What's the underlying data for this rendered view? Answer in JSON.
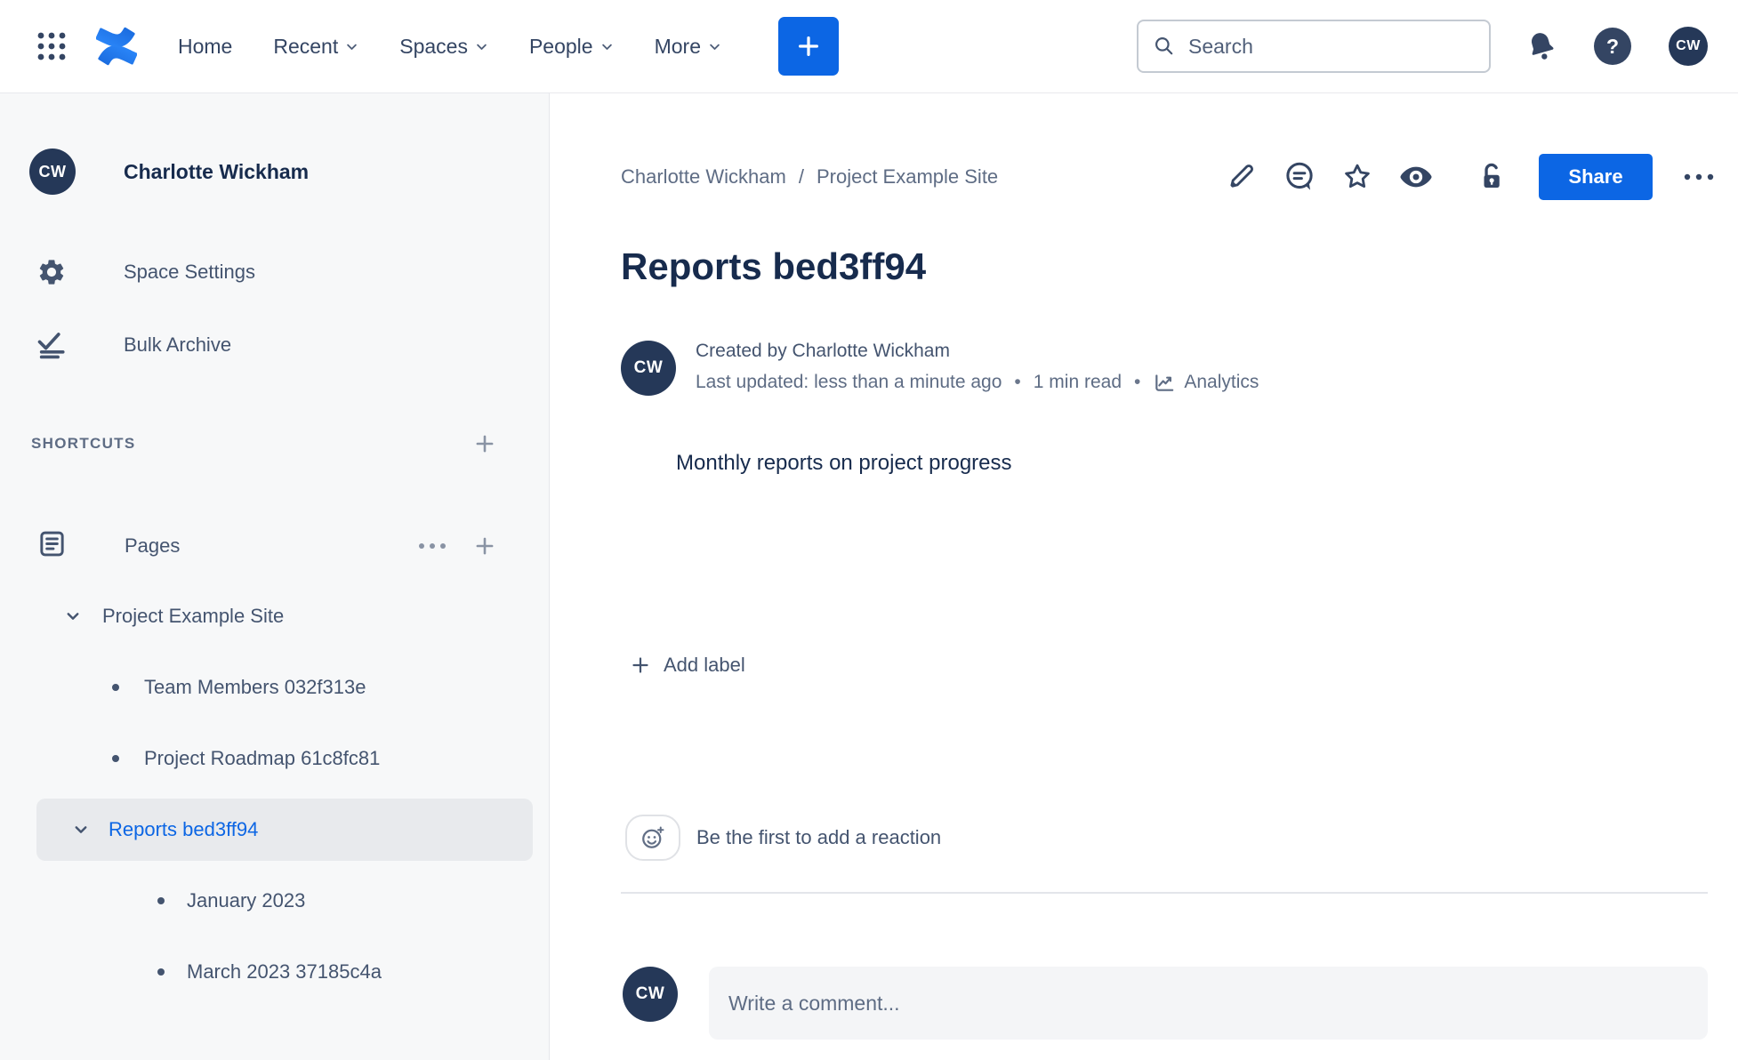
{
  "topbar": {
    "nav": [
      {
        "label": "Home",
        "dropdown": false
      },
      {
        "label": "Recent",
        "dropdown": true
      },
      {
        "label": "Spaces",
        "dropdown": true
      },
      {
        "label": "People",
        "dropdown": true
      },
      {
        "label": "More",
        "dropdown": true
      }
    ],
    "search_placeholder": "Search",
    "help_glyph": "?",
    "user_initials": "CW"
  },
  "sidebar": {
    "space_initials": "CW",
    "space_name": "Charlotte Wickham",
    "settings_label": "Space Settings",
    "bulk_archive_label": "Bulk Archive",
    "shortcuts_heading": "SHORTCUTS",
    "pages_label": "Pages",
    "tree": [
      {
        "label": "Project Example Site",
        "level": 1,
        "marker": "chevron-down",
        "selected": false
      },
      {
        "label": "Team Members 032f313e",
        "level": 2,
        "marker": "bullet",
        "selected": false
      },
      {
        "label": "Project Roadmap 61c8fc81",
        "level": 2,
        "marker": "bullet",
        "selected": false
      },
      {
        "label": "Reports bed3ff94",
        "level": 2,
        "marker": "chevron-down",
        "selected": true
      },
      {
        "label": "January 2023",
        "level": 3,
        "marker": "bullet",
        "selected": false
      },
      {
        "label": "March 2023 37185c4a",
        "level": 3,
        "marker": "bullet",
        "selected": false
      }
    ]
  },
  "main": {
    "breadcrumb": {
      "first": "Charlotte Wickham",
      "separator": "/",
      "second": "Project Example Site"
    },
    "share_label": "Share",
    "title": "Reports bed3ff94",
    "byline": {
      "initials": "CW",
      "created": "Created by Charlotte Wickham",
      "updated": "Last updated: less than a minute ago",
      "dot": "•",
      "read_time": "1 min read",
      "analytics_label": "Analytics"
    },
    "body_text": "Monthly reports on project progress",
    "add_label_text": "Add label",
    "reaction_prompt": "Be the first to add a reaction",
    "comment": {
      "initials": "CW",
      "placeholder": "Write a comment..."
    }
  },
  "colors": {
    "primary_blue": "#0C66E4",
    "logo_blue_dark": "#1868DB",
    "logo_blue_light": "#2E8CFF",
    "title_text": "#172B4D",
    "icon_navy": "#344563",
    "sidebar_bg": "#F7F8F9",
    "selected_row_bg": "#E8EAED"
  },
  "icons": {
    "app-grid-icon": "3x3 dot grid",
    "confluence-logo": "two blue swooshes",
    "chevron-down-icon": "⌄",
    "plus-icon": "+",
    "search-icon": "magnifier",
    "bell-icon": "notification bell",
    "help-icon": "? in circle",
    "gear-icon": "settings gear",
    "bulk-archive-icon": "checkmark with lines",
    "pages-icon": "document with lines",
    "ellipsis-icon": "•••",
    "bullet-icon": "•",
    "edit-icon": "pencil",
    "comment-icon": "speech bubble",
    "star-icon": "star outline",
    "watch-icon": "filled eye",
    "unlock-icon": "open padlock",
    "analytics-icon": "trend line chart",
    "add-reaction-icon": "smiley with sparkle"
  }
}
